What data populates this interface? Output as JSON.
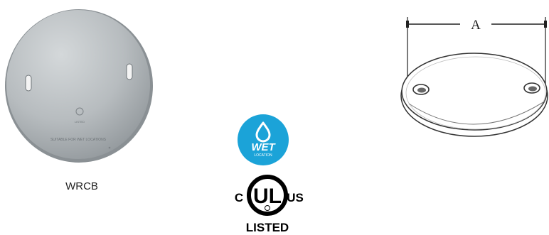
{
  "product": {
    "photo_plate_text": {
      "certification_line": "LISTED",
      "wet_location_line": "SUITABLE FOR WET LOCATIONS"
    },
    "caption": "WRCB"
  },
  "badges": {
    "wet_location": {
      "main_text": "WET",
      "sub_text": "LOCATION",
      "color": "#1ba3d8"
    },
    "ul_listing": {
      "left_text": "C",
      "center_text": "UL",
      "right_text": "US",
      "bottom_text": "LISTED"
    }
  },
  "drawing": {
    "dimension_label": "A"
  }
}
